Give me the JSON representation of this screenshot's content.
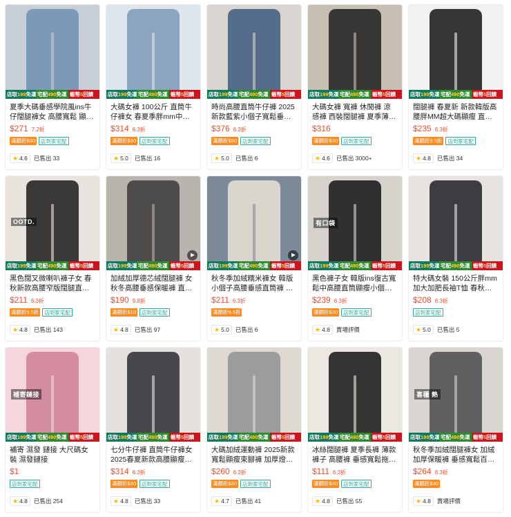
{
  "banner": {
    "pickup_label": "店取",
    "pickup_price": "199",
    "pickup_tail": "免運",
    "home_label": "宅配",
    "home_price": "490",
    "home_tail": "免運",
    "promo_label": "蝦幣",
    "promo_value": "5",
    "promo_tail": "回饋"
  },
  "products": [
    {
      "title": "夏季大碼垂感學院風ins牛仔闊腿褲女 高腰寬鬆 顯瘦…",
      "price": "$271",
      "discount": "7.2折",
      "tags": [
        "滿額折$30",
        "店到家宅配"
      ],
      "rating": "4.6",
      "sold": "已售出 33",
      "video": false,
      "colors": [
        "#c9cfd6",
        "#6f8fb3"
      ],
      "photo_text": ""
    },
    {
      "title": "大碼女褲 100公斤 直筒牛仔褲女 春夏季胖mm中腰寬…",
      "price": "$314",
      "discount": "6.3折",
      "tags": [
        "滿額折$30",
        "店到家宅配"
      ],
      "rating": "5.0",
      "sold": "已售出 16",
      "video": false,
      "colors": [
        "#dfe5ec",
        "#7d9ab8"
      ],
      "photo_text": ""
    },
    {
      "title": "時尚高腰直筒牛仔褲 2025新款藍紫小個子寬鬆垂感…",
      "price": "$376",
      "discount": "6.3折",
      "tags": [
        "滿額折$50",
        "店到家宅配"
      ],
      "rating": "5.0",
      "sold": "已售出 6",
      "video": false,
      "colors": [
        "#d8d4cf",
        "#3e5b7e"
      ],
      "photo_text": ""
    },
    {
      "title": "大碼女褲 寬褲 休閒褲 涼感褲 西裝闊腿褲 夏季薄款 …",
      "price": "$316",
      "discount": "",
      "tags": [
        "滿額折$30",
        "店到家宅配"
      ],
      "rating": "4.6",
      "sold": "已售出 3000+",
      "video": false,
      "colors": [
        "#c8bfb3",
        "#1e1e1e"
      ],
      "photo_text": ""
    },
    {
      "title": "闊腿褲 春夏新 新款韓版高腰胖MM超大碼顯瘦 直筒褲…",
      "price": "$235",
      "discount": "6.3折",
      "tags": [
        "滿額折9.5折",
        "店到家宅配"
      ],
      "rating": "4.8",
      "sold": "已售出 34",
      "video": false,
      "colors": [
        "#f2f2f2",
        "#151515"
      ],
      "photo_text": ""
    },
    {
      "title": "黑色闊叉微喇叭褲子女 春秋新款高腰窄版闊腿直筒休…",
      "price": "$211",
      "discount": "6.3折",
      "tags": [
        "滿額折9.5折",
        "店到家宅配"
      ],
      "rating": "4.8",
      "sold": "已售出 143",
      "video": false,
      "colors": [
        "#e8e3dc",
        "#1b1b1b"
      ],
      "photo_text": "OOTD."
    },
    {
      "title": "加絨加厚德芯絨闊腿褲 女秋冬高腰垂感保暖褲 直筒…",
      "price": "$190",
      "discount": "9.8折",
      "tags": [
        "滿額折$10",
        "店到家宅配"
      ],
      "rating": "4.8",
      "sold": "已售出 97",
      "video": true,
      "colors": [
        "#b9b4ae",
        "#3a3a3a"
      ],
      "photo_text": ""
    },
    {
      "title": "秋冬季加絨糯米褲女 韓版小個子高腰垂感直筒褲 寬鬆…",
      "price": "$211",
      "discount": "6.3折",
      "tags": [
        "滿額折9.5折"
      ],
      "rating": "5.0",
      "sold": "已售出 6",
      "video": true,
      "colors": [
        "#7d8a99",
        "#e9e3d6"
      ],
      "photo_text": ""
    },
    {
      "title": "黑色褲子女 韓版ins復古寬鬆中高腰直筒顯瘦小個子…",
      "price": "$239",
      "discount": "6.3折",
      "tags": [
        "滿額折$30",
        "店到家宅配"
      ],
      "rating": "4.8",
      "sold": "賣場評價",
      "video": false,
      "colors": [
        "#d6d2cc",
        "#141414"
      ],
      "photo_text": "有口袋"
    },
    {
      "title": "特大碼女裝 150公斤胖mm 加大加肥長袖T恤 春秋薄…",
      "price": "$208",
      "discount": "6.3折",
      "tags": [
        "店到家宅配"
      ],
      "rating": "5.0",
      "sold": "已售出 5",
      "video": false,
      "colors": [
        "#e6e3e0",
        "#1f1f24"
      ],
      "photo_text": ""
    },
    {
      "title": "補寄 濕發 鏈接 大尺碼女裝 濕發鏈接",
      "price": "$1",
      "discount": "",
      "tags": [
        "店到家宅配"
      ],
      "rating": "4.8",
      "sold": "已售出 254",
      "video": false,
      "colors": [
        "#f4d6dc",
        "#cc7f95"
      ],
      "photo_text": "補寄鏈接"
    },
    {
      "title": "七分牛仔褲 直筒牛仔褲女 2025春夏新款高腰顯瘦黑…",
      "price": "$314",
      "discount": "6.3折",
      "tags": [
        "滿額折$30",
        "店到家宅配"
      ],
      "rating": "4.8",
      "sold": "已售出 33",
      "video": false,
      "colors": [
        "#e5e2de",
        "#2b2d33"
      ],
      "photo_text": ""
    },
    {
      "title": "大碼加絨運動褲 2025新款寬鬆顯瘦束腳褲 加厚燈籠…",
      "price": "$260",
      "discount": "6.3折",
      "tags": [
        "滿額折$30",
        "店到家宅配"
      ],
      "rating": "4.7",
      "sold": "已售出 41",
      "video": false,
      "colors": [
        "#ddd8d0",
        "#8f9394"
      ],
      "photo_text": ""
    },
    {
      "title": "冰絲闊腿褲 夏季長褲 薄款褲子 高腰褲 垂感寬鬆拖…",
      "price": "$111",
      "discount": "6.3折",
      "tags": [
        "滿額折$30",
        "店到家宅配"
      ],
      "rating": "4.8",
      "sold": "已售出 55",
      "video": false,
      "colors": [
        "#ebe8e2",
        "#141414"
      ],
      "photo_text": ""
    },
    {
      "title": "秋冬季加絨闊腿褲女 加絨加厚保暖褲 垂感寬鬆百搭休…",
      "price": "$264",
      "discount": "6.3折",
      "tags": [
        "滿額折$30"
      ],
      "rating": "4.8",
      "sold": "賣場評價",
      "video": false,
      "colors": [
        "#d9d5d0",
        "#4a4a4e"
      ],
      "photo_text": "喜穩 熱"
    }
  ]
}
